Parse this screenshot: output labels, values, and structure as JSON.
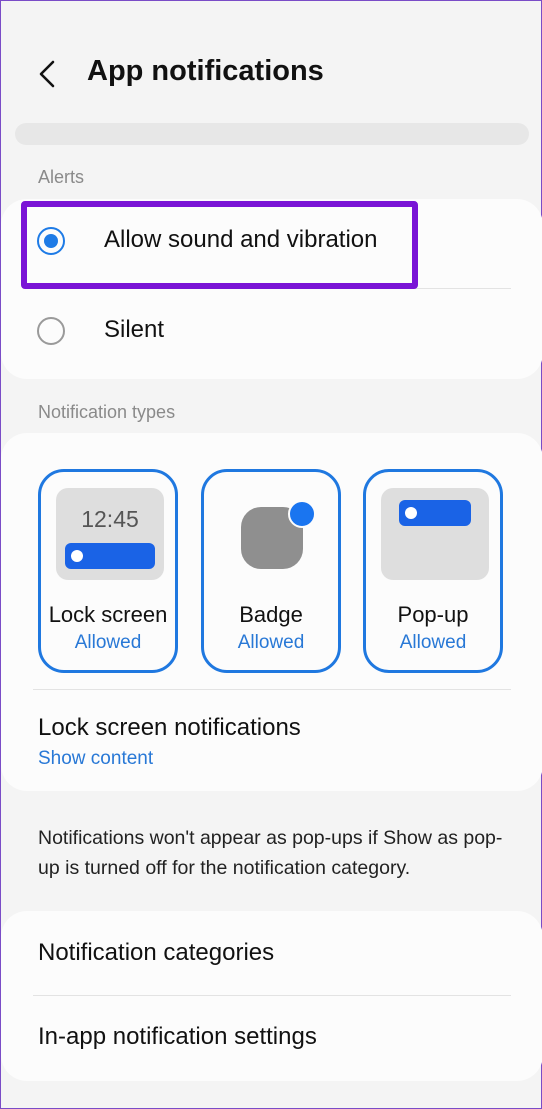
{
  "header": {
    "back_icon": "chevron-left-icon",
    "title": "App notifications"
  },
  "alerts": {
    "section_label": "Alerts",
    "options": [
      {
        "label": "Allow sound and vibration",
        "selected": true
      },
      {
        "label": "Silent",
        "selected": false
      }
    ],
    "highlight_color": "#7a14d6"
  },
  "notification_types": {
    "section_label": "Notification types",
    "tiles": [
      {
        "label": "Lock screen",
        "status": "Allowed",
        "preview_time": "12:45"
      },
      {
        "label": "Badge",
        "status": "Allowed"
      },
      {
        "label": "Pop-up",
        "status": "Allowed"
      }
    ],
    "lock_screen_notifications": {
      "title": "Lock screen notifications",
      "value": "Show content"
    }
  },
  "note": "Notifications won't appear as pop-ups if Show as pop-up is turned off for the notification category.",
  "more_settings": {
    "items": [
      {
        "label": "Notification categories"
      },
      {
        "label": "In-app notification settings"
      }
    ]
  },
  "colors": {
    "accent": "#1f78e0",
    "background": "#f4f4f4",
    "card": "#fcfcfc"
  }
}
